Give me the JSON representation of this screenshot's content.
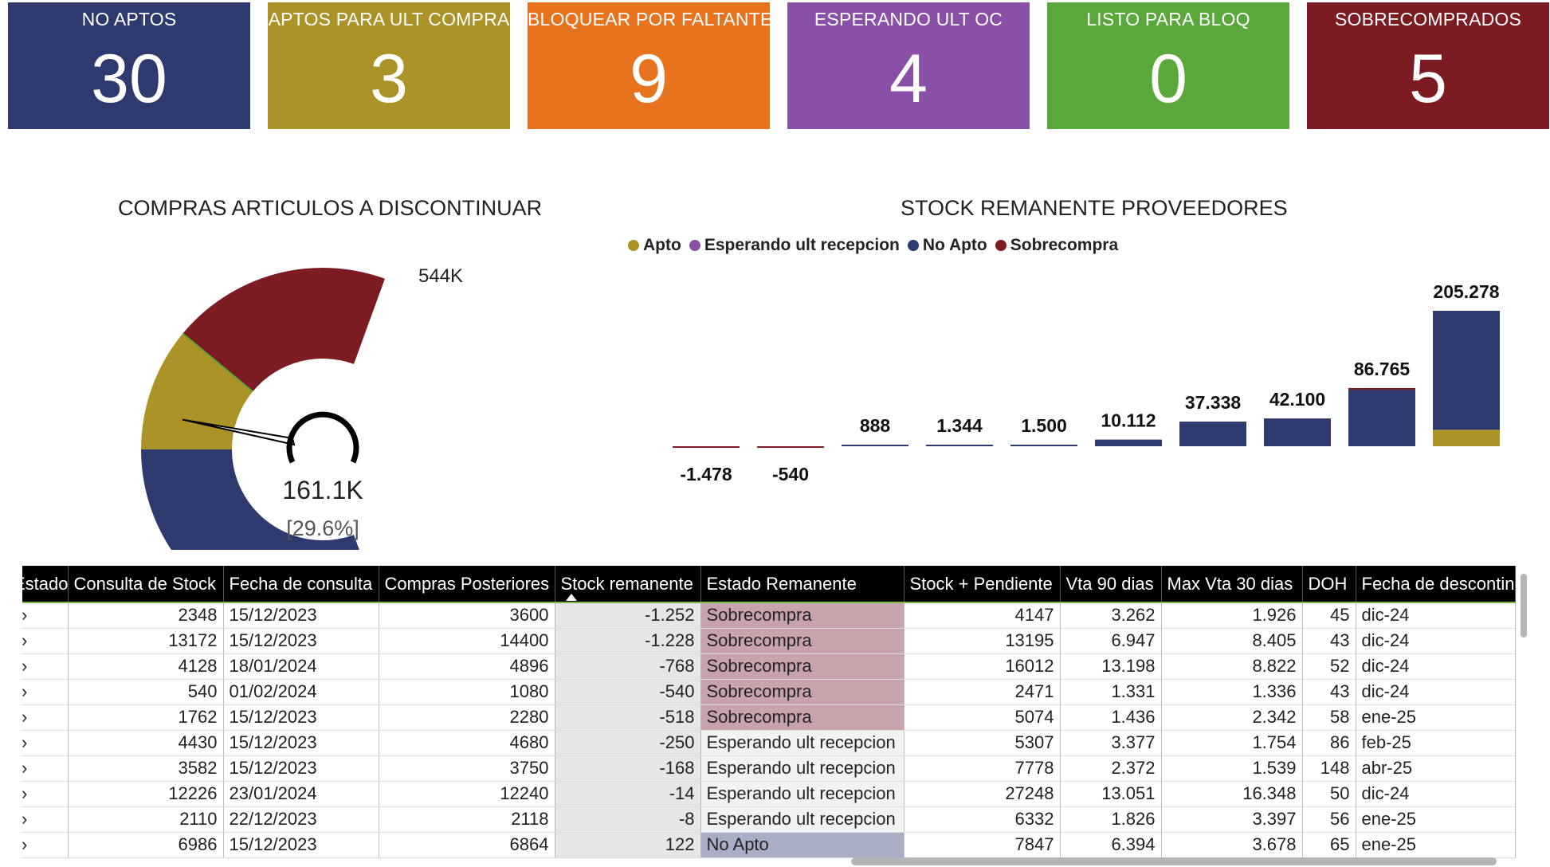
{
  "colors": {
    "no_aptos": "#2e3a6e",
    "aptos_ult_compra": "#ab9327",
    "bloquear_faltante": "#e8731f",
    "esperando_ult_oc": "#8a4fa6",
    "listo_bloq": "#5aa83a",
    "sobrecomprados": "#7c1c22",
    "apto": "#ab9327",
    "esperando": "#8a4fa6",
    "no_apto": "#2e3a6e",
    "sobrecompra": "#7c1c22"
  },
  "kpis": [
    {
      "label": "NO APTOS",
      "value": "30"
    },
    {
      "label": "APTOS PARA ULT COMPRA",
      "value": "3"
    },
    {
      "label": "BLOQUEAR POR FALTANTE",
      "value": "9"
    },
    {
      "label": "ESPERANDO ULT OC",
      "value": "4"
    },
    {
      "label": "LISTO PARA BLOQ",
      "value": "0"
    },
    {
      "label": "SOBRECOMPRADOS",
      "value": "5"
    }
  ],
  "gauge": {
    "title": "COMPRAS ARTICULOS A DISCONTINUAR",
    "max_label": "544K",
    "value_label": "161.1K",
    "pct_label": "[29.6%]"
  },
  "bars": {
    "title": "STOCK REMANENTE PROVEEDORES",
    "legend": [
      "Apto",
      "Esperando ult recepcion",
      "No Apto",
      "Sobrecompra"
    ]
  },
  "chart_data": [
    {
      "type": "gauge",
      "title": "COMPRAS ARTICULOS A DISCONTINUAR",
      "total": 544000,
      "value": 161100,
      "percent": 29.6,
      "segments": [
        {
          "name": "No Apto",
          "fraction": 0.5
        },
        {
          "name": "Apto",
          "fraction": 0.18
        },
        {
          "name": "Sobrecompra",
          "fraction": 0.32
        }
      ]
    },
    {
      "type": "bar",
      "title": "STOCK REMANENTE PROVEEDORES",
      "stacked": true,
      "legend_position": "top",
      "categories": [
        "",
        "",
        "",
        "",
        "",
        "",
        "",
        "",
        "",
        ""
      ],
      "totals": [
        -1478,
        -540,
        888,
        1344,
        1500,
        10112,
        37338,
        42100,
        86765,
        205278
      ],
      "total_labels": [
        "-1.478",
        "-540",
        "888",
        "1.344",
        "1.500",
        "10.112",
        "37.338",
        "42.100",
        "86.765",
        "205.278"
      ],
      "series": [
        {
          "name": "Apto",
          "values": [
            0,
            0,
            0,
            0,
            0,
            0,
            0,
            0,
            0,
            25000
          ]
        },
        {
          "name": "Esperando ult recepcion",
          "values": [
            0,
            0,
            0,
            0,
            0,
            0,
            0,
            0,
            0,
            0
          ]
        },
        {
          "name": "No Apto",
          "values": [
            0,
            0,
            888,
            1344,
            1500,
            10112,
            37338,
            42100,
            85765,
            180278
          ]
        },
        {
          "name": "Sobrecompra",
          "values": [
            -1478,
            -540,
            0,
            0,
            0,
            0,
            0,
            0,
            1000,
            0
          ]
        }
      ],
      "ylim": [
        -1478,
        205278
      ]
    }
  ],
  "table": {
    "columns": [
      {
        "label": "Estado",
        "width": 57
      },
      {
        "label": "Consulta de Stock",
        "width": 195
      },
      {
        "label": "Fecha de consulta",
        "width": 195
      },
      {
        "label": "Compras Posteriores",
        "width": 221
      },
      {
        "label": "Stock remanente",
        "width": 183
      },
      {
        "label": "Estado Remanente",
        "width": 255
      },
      {
        "label": "Stock + Pendiente",
        "width": 196
      },
      {
        "label": "Vta 90 dias",
        "width": 127
      },
      {
        "label": "Max Vta 30 dias",
        "width": 177
      },
      {
        "label": "DOH",
        "width": 67
      },
      {
        "label": "Fecha de descontinuacion",
        "width": 200
      }
    ],
    "rows": [
      [
        "›",
        "2348",
        "15/12/2023",
        "3600",
        "-1.252",
        "Sobrecompra",
        "4147",
        "3.262",
        "1.926",
        "45",
        "dic-24"
      ],
      [
        "›",
        "13172",
        "15/12/2023",
        "14400",
        "-1.228",
        "Sobrecompra",
        "13195",
        "6.947",
        "8.405",
        "43",
        "dic-24"
      ],
      [
        "›",
        "4128",
        "18/01/2024",
        "4896",
        "-768",
        "Sobrecompra",
        "16012",
        "13.198",
        "8.822",
        "52",
        "dic-24"
      ],
      [
        "›",
        "540",
        "01/02/2024",
        "1080",
        "-540",
        "Sobrecompra",
        "2471",
        "1.331",
        "1.336",
        "43",
        "dic-24"
      ],
      [
        "›",
        "1762",
        "15/12/2023",
        "2280",
        "-518",
        "Sobrecompra",
        "5074",
        "1.436",
        "2.342",
        "58",
        "ene-25"
      ],
      [
        "›",
        "4430",
        "15/12/2023",
        "4680",
        "-250",
        "Esperando ult recepcion",
        "5307",
        "3.377",
        "1.754",
        "86",
        "feb-25"
      ],
      [
        "›",
        "3582",
        "15/12/2023",
        "3750",
        "-168",
        "Esperando ult recepcion",
        "7778",
        "2.372",
        "1.539",
        "148",
        "abr-25"
      ],
      [
        "›",
        "12226",
        "23/01/2024",
        "12240",
        "-14",
        "Esperando ult recepcion",
        "27248",
        "13.051",
        "16.348",
        "50",
        "dic-24"
      ],
      [
        "›",
        "2110",
        "22/12/2023",
        "2118",
        "-8",
        "Esperando ult recepcion",
        "6332",
        "1.826",
        "3.397",
        "56",
        "ene-25"
      ],
      [
        "›",
        "6986",
        "15/12/2023",
        "6864",
        "122",
        "No Apto",
        "7847",
        "6.394",
        "3.678",
        "65",
        "ene-25"
      ]
    ]
  }
}
